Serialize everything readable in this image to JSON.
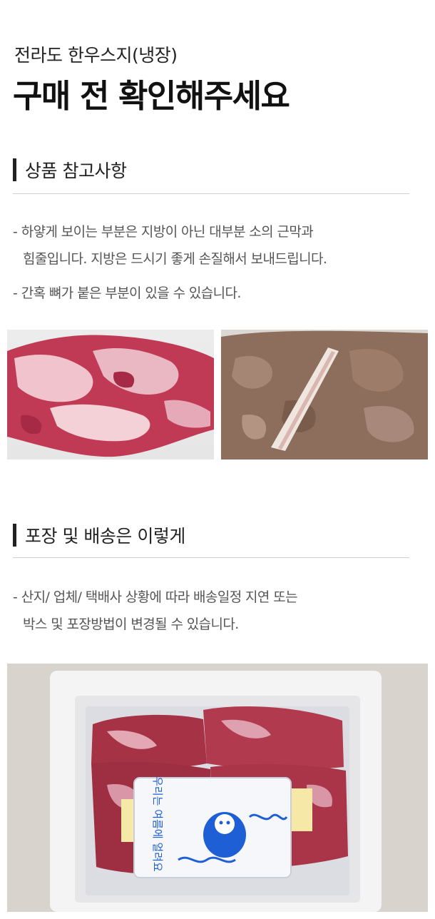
{
  "header": {
    "subtitle": "전라도 한우스지(냉장)",
    "title": "구매 전 확인해주세요"
  },
  "section1": {
    "title": "상품 참고사항",
    "notes": [
      "- 하얗게 보이는 부분은 지방이 아닌 대부분 소의 근막과",
      "힘줄입니다. 지방은 드시기 좋게 손질해서 보내드립니다.",
      "- 간혹 뼈가 붙은 부분이 있을 수 있습니다."
    ]
  },
  "section2": {
    "title": "포장 및 배송은 이렇게",
    "notes": [
      "- 산지/ 업체/ 택배사 상황에 따라 배송일정 지연 또는",
      "박스 및 포장방법이 변경될 수 있습니다."
    ]
  },
  "packaging_photo": {
    "ice_pack_text": "우리는 여름에 얼려요"
  },
  "colors": {
    "accent_bar": "#222222",
    "meat": "#b8324a",
    "fat": "#f2c6cf",
    "cooked_meat": "#8a6a58",
    "ice_pack_blue": "#1f5fd6"
  }
}
